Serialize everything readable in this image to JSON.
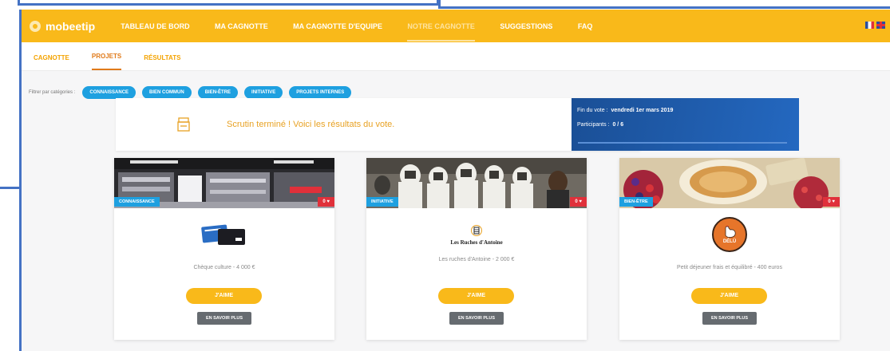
{
  "brand": {
    "name": "mobeetip"
  },
  "nav": {
    "items": [
      {
        "label": "TABLEAU DE BORD"
      },
      {
        "label": "MA CAGNOTTE"
      },
      {
        "label": "MA CAGNOTTE D'EQUIPE"
      },
      {
        "label": "NOTRE CAGNOTTE"
      },
      {
        "label": "SUGGESTIONS"
      },
      {
        "label": "FAQ"
      }
    ],
    "active": "NOTRE CAGNOTTE"
  },
  "subnav": {
    "items": [
      {
        "label": "CAGNOTTE"
      },
      {
        "label": "PROJETS"
      },
      {
        "label": "RÉSULTATS"
      }
    ],
    "active": "PROJETS"
  },
  "filters": {
    "label": "Filtrer par catégories :",
    "chips": [
      {
        "label": "CONNAISSANCE"
      },
      {
        "label": "BIEN COMMUN"
      },
      {
        "label": "BIEN-ÊTRE"
      },
      {
        "label": "INITIATIVE"
      },
      {
        "label": "PROJETS INTERNES"
      }
    ]
  },
  "banner": {
    "text": "Scrutin terminé ! Voici les résultats du vote."
  },
  "vote": {
    "end_label": "Fin du vote :",
    "end_value": "vendredi 1er mars 2019",
    "participants_label": "Participants :",
    "participants_value": "0 / 6"
  },
  "cards": [
    {
      "category": "CONNAISSANCE",
      "likes": "0 ♥",
      "title": "Chèque culture - 4 000 €",
      "like_label": "J'AIME",
      "more_label": "EN SAVOIR PLUS"
    },
    {
      "category": "INITIATIVE",
      "likes": "0 ♥",
      "title": "Les ruches d'Antoine - 2 000 €",
      "logo_text": "Les Ruches d'Antoine",
      "like_label": "J'AIME",
      "more_label": "EN SAVOIR PLUS"
    },
    {
      "category": "BIEN-ÊTRE",
      "likes": "0 ♥",
      "title": "Petit déjeuner frais et équilibré - 400 euros",
      "logo_text": "DÉLÜ",
      "like_label": "J'AIME",
      "more_label": "EN SAVOIR PLUS"
    }
  ],
  "colors": {
    "accent": "#f9b91a",
    "primary": "#1ea0e0",
    "vote_panel": "#1a4f96",
    "like": "#e0303a"
  },
  "icons": [
    "flag-fr-icon",
    "flag-uk-icon",
    "box-icon",
    "heart-icon"
  ]
}
